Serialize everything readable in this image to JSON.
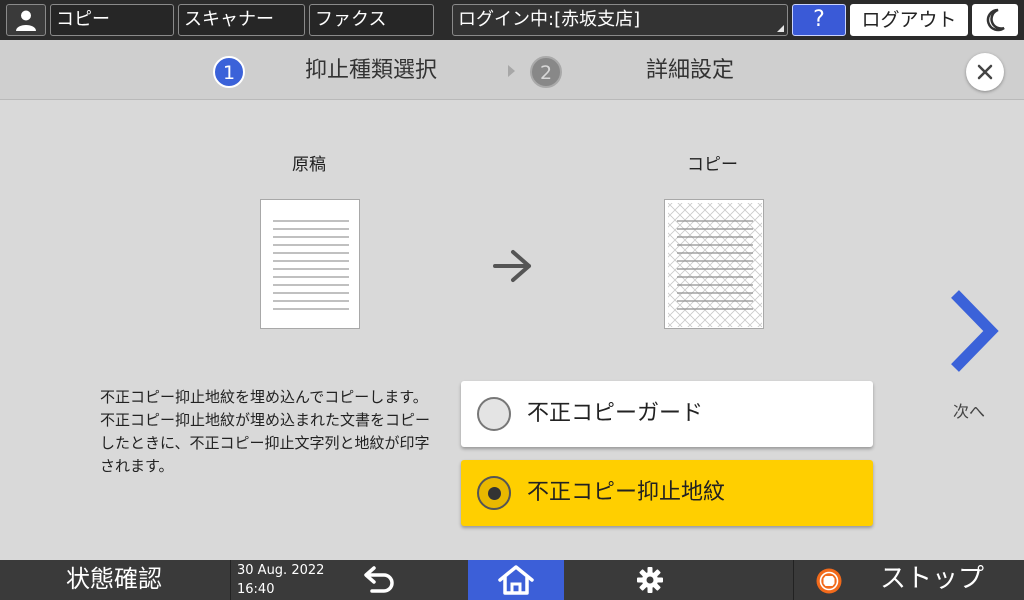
{
  "topbar": {
    "user_icon": "user-icon",
    "copy_label": "コピー",
    "scanner_label": "スキャナー",
    "fax_label": "ファクス",
    "login_status": "ログイン中:[赤坂支店]",
    "help_label": "?",
    "logout_label": "ログアウト",
    "energy_icon": "moon-icon"
  },
  "steps": [
    {
      "number": "1",
      "label": "抑止種類選択",
      "active": true
    },
    {
      "number": "2",
      "label": "詳細設定",
      "active": false
    }
  ],
  "close_icon": "close-icon",
  "illustration": {
    "original_caption": "原稿",
    "copy_caption": "コピー",
    "arrow_icon": "arrow-right-icon"
  },
  "description": "不正コピー抑止地紋を埋め込んでコピーします。不正コピー抑止地紋が埋め込まれた文書をコピーしたときに、不正コピー抑止文字列と地紋が印字されます。",
  "options": [
    {
      "label": "不正コピーガード",
      "selected": false
    },
    {
      "label": "不正コピー抑止地紋",
      "selected": true
    }
  ],
  "next": {
    "icon": "chevron-right-icon",
    "label": "次へ"
  },
  "bottombar": {
    "status_label": "状態確認",
    "date": "30 Aug. 2022",
    "time": "16:40",
    "back_icon": "back-icon",
    "home_icon": "home-icon",
    "settings_icon": "gear-icon",
    "stop_icon": "stop-icon",
    "stop_label": "ストップ"
  },
  "colors": {
    "accent_blue": "#3b62d9",
    "selected_yellow": "#ffcf00",
    "stop_orange": "#f26a1b"
  }
}
